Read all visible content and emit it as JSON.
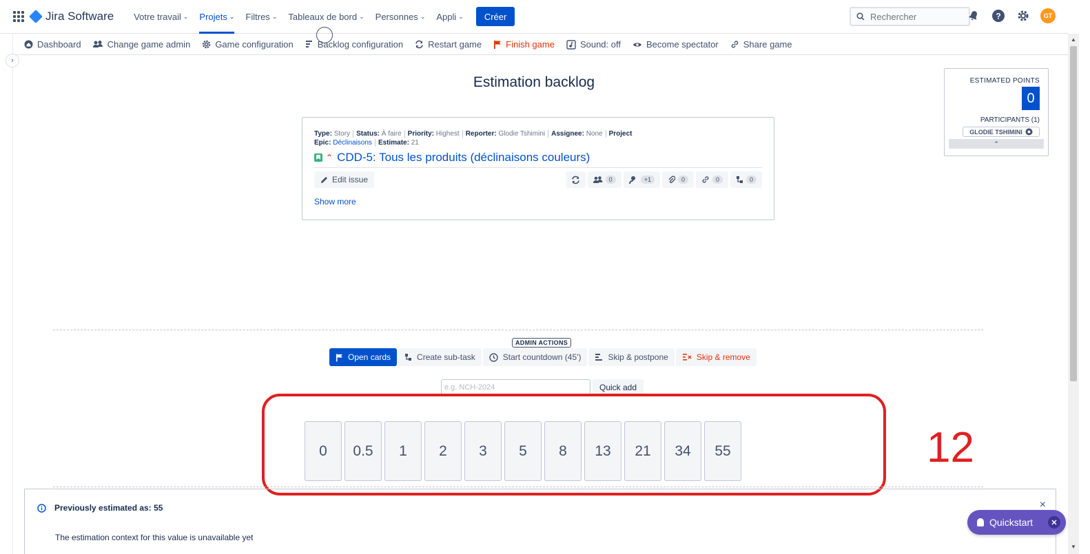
{
  "topnav": {
    "product": "Jira Software",
    "items": [
      {
        "label": "Votre travail",
        "active": false
      },
      {
        "label": "Projets",
        "active": true
      },
      {
        "label": "Filtres",
        "active": false
      },
      {
        "label": "Tableaux de bord",
        "active": false
      },
      {
        "label": "Personnes",
        "active": false
      },
      {
        "label": "Appli",
        "active": false
      }
    ],
    "create_label": "Créer",
    "search_placeholder": "Rechercher",
    "avatar_initials": "GT"
  },
  "toolbar": {
    "items": [
      {
        "label": "Dashboard",
        "icon": "home-icon"
      },
      {
        "label": "Change game admin",
        "icon": "people-icon"
      },
      {
        "label": "Game configuration",
        "icon": "gear-icon"
      },
      {
        "label": "Backlog configuration",
        "icon": "backlog-icon"
      },
      {
        "label": "Restart game",
        "icon": "refresh-icon"
      },
      {
        "label": "Finish game",
        "icon": "flag-icon"
      },
      {
        "label": "Sound: off",
        "icon": "sound-icon"
      },
      {
        "label": "Become spectator",
        "icon": "eye-icon"
      },
      {
        "label": "Share game",
        "icon": "link-icon"
      }
    ]
  },
  "page": {
    "title": "Estimation backlog"
  },
  "issue": {
    "type_label": "Type:",
    "type": "Story",
    "status_label": "Status:",
    "status": "À faire",
    "priority_label": "Priority:",
    "priority": "Highest",
    "reporter_label": "Reporter:",
    "reporter": "Glodie Tshimini",
    "assignee_label": "Assignee:",
    "assignee": "None",
    "project_label": "Project",
    "epic_label": "Epic:",
    "epic": "Déclinaisons",
    "estimate_label": "Estimate:",
    "estimate": "21",
    "title": "CDD-5: Tous les produits (déclinaisons couleurs)",
    "edit_label": "Edit issue",
    "counts": {
      "team": "0",
      "voters": "+1",
      "attachments": "0",
      "links": "0",
      "subtasks": "0"
    },
    "show_more": "Show more"
  },
  "estimation": {
    "points_label": "ESTIMATED POINTS",
    "points": "0",
    "participants_label": "PARTICIPANTS (1)",
    "participant": "GLODIE TSHIMINI"
  },
  "admin": {
    "label": "ADMIN ACTIONS",
    "open_cards": "Open cards",
    "create_subtask": "Create sub-task",
    "start_countdown": "Start countdown (45')",
    "skip_postpone": "Skip & postpone",
    "skip_remove": "Skip & remove",
    "quickadd_placeholder": "e.g. NCH-2024",
    "quickadd_button": "Quick add"
  },
  "cards": [
    "0",
    "0.5",
    "1",
    "2",
    "3",
    "5",
    "8",
    "13",
    "21",
    "34",
    "55"
  ],
  "annotation": "12",
  "previous": {
    "heading": "Previously estimated as: 55",
    "text": "The estimation context for this value is unavailable yet",
    "close": "×"
  },
  "quickstart": {
    "label": "Quickstart"
  },
  "colors": {
    "brand": "#0052cc",
    "danger": "#de350b",
    "annotation": "#e02020",
    "quickstart": "#6554c0"
  }
}
